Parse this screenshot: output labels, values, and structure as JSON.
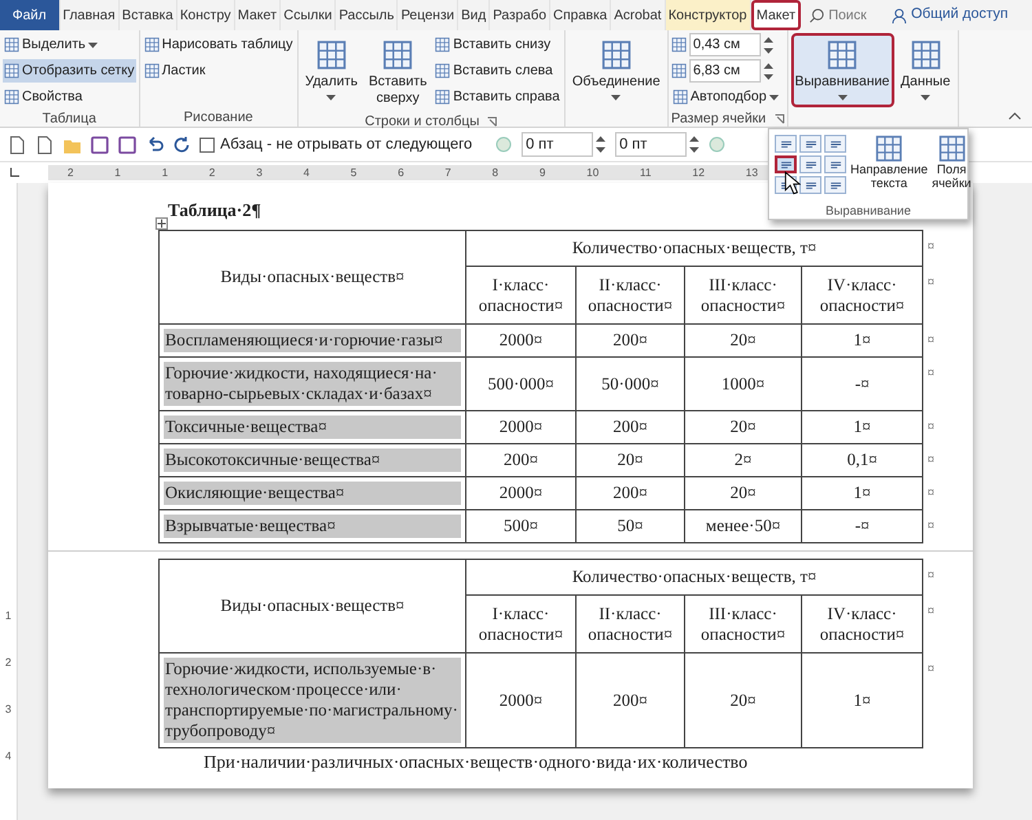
{
  "tabs": [
    {
      "label": "Файл",
      "kind": "file",
      "selected": false
    },
    {
      "label": "Главная",
      "kind": "tab",
      "selected": false
    },
    {
      "label": "Вставка",
      "kind": "tab",
      "selected": false
    },
    {
      "label": "Констру",
      "kind": "tab",
      "selected": false
    },
    {
      "label": "Макет",
      "kind": "tab",
      "selected": false
    },
    {
      "label": "Ссылки",
      "kind": "tab",
      "selected": false
    },
    {
      "label": "Рассыль",
      "kind": "tab",
      "selected": false
    },
    {
      "label": "Рецензи",
      "kind": "tab",
      "selected": false
    },
    {
      "label": "Вид",
      "kind": "tab",
      "selected": false
    },
    {
      "label": "Разрабо",
      "kind": "tab",
      "selected": false
    },
    {
      "label": "Справка",
      "kind": "tab",
      "selected": false
    },
    {
      "label": "Acrobat",
      "kind": "tab",
      "selected": false
    },
    {
      "label": "Конструктор",
      "kind": "context",
      "selected": false
    },
    {
      "label": "Макет",
      "kind": "context",
      "selected": true
    }
  ],
  "search": {
    "placeholder": "Поиск"
  },
  "share": {
    "label": "Общий доступ"
  },
  "ribbon": {
    "groups": [
      {
        "label": "Таблица",
        "launcher": false,
        "items": [
          {
            "kind": "small",
            "label": "Выделить",
            "dropdown": true,
            "active": false
          },
          {
            "kind": "small",
            "label": "Отобразить сетку",
            "dropdown": false,
            "active": true
          },
          {
            "kind": "small",
            "label": "Свойства",
            "dropdown": false,
            "active": false
          }
        ]
      },
      {
        "label": "Рисование",
        "launcher": false,
        "items": [
          {
            "kind": "small",
            "label": "Нарисовать таблицу",
            "dropdown": false,
            "active": false
          },
          {
            "kind": "small",
            "label": "Ластик",
            "dropdown": false,
            "active": false
          }
        ]
      },
      {
        "label": "Строки и столбцы",
        "launcher": true,
        "items": [
          {
            "kind": "large",
            "label": "Удалить",
            "dropdown": true,
            "active": false
          },
          {
            "kind": "large",
            "label": "Вставить сверху",
            "dropdown": false,
            "active": false
          },
          {
            "kind": "small",
            "label": "Вставить снизу",
            "dropdown": false,
            "active": false
          },
          {
            "kind": "small",
            "label": "Вставить слева",
            "dropdown": false,
            "active": false
          },
          {
            "kind": "small",
            "label": "Вставить справа",
            "dropdown": false,
            "active": false
          }
        ]
      },
      {
        "launcher": false,
        "items": [
          {
            "kind": "large",
            "label": "Объединение",
            "dropdown": true,
            "active": false
          }
        ]
      },
      {
        "label": "Размер ячейки",
        "launcher": true,
        "items": [
          {
            "kind": "field",
            "value": "0,43 см",
            "active": false
          },
          {
            "kind": "field",
            "value": "6,83 см",
            "active": false
          },
          {
            "kind": "small",
            "label": "Автоподбор",
            "dropdown": true,
            "active": false
          }
        ]
      },
      {
        "launcher": false,
        "items": [
          {
            "kind": "large",
            "label": "Выравнивание",
            "dropdown": true,
            "active": true
          },
          {
            "kind": "large",
            "label": "Данные",
            "dropdown": true,
            "active": false
          }
        ]
      }
    ]
  },
  "quick_access": {
    "checkbox": {
      "label": "Абзац - не отрывать от следующего",
      "checked": false
    },
    "fields": [
      {
        "value": "0 пт"
      },
      {
        "value": "0 пт"
      }
    ]
  },
  "ruler": {
    "numbers": [
      "2",
      "1",
      "1",
      "2",
      "3",
      "4",
      "5",
      "6",
      "7",
      "8",
      "9",
      "10",
      "11",
      "12",
      "13"
    ]
  },
  "vertical_ruler": {
    "numbers": [
      "1",
      "2",
      "3",
      "4"
    ]
  },
  "alignment_menu": {
    "cells": [
      {
        "selected": false
      },
      {
        "selected": false
      },
      {
        "selected": false
      },
      {
        "selected": true
      },
      {
        "selected": false
      },
      {
        "selected": false
      },
      {
        "selected": false
      },
      {
        "selected": false
      },
      {
        "selected": false
      }
    ],
    "buttons": [
      {
        "label": "Направление текста"
      },
      {
        "label": "Поля ячейки"
      }
    ],
    "label": "Выравнивание"
  },
  "document": {
    "caption": "Таблица·2¶",
    "tables": [
      {
        "header": {
          "name_heading": "Виды·опасных·веществ¤",
          "group_heading": "Количество·опасных·веществ, т¤",
          "class_headings": [
            "I·класс·опасности¤",
            "II·класс·опасности¤",
            "III·класс·опасности¤",
            "IV·класс·опасности¤"
          ],
          "end_marks": [
            "¤",
            "¤"
          ]
        },
        "rows": [
          {
            "name": "Воспламеняющиеся·и·горючие·газы¤",
            "values": [
              "2000¤",
              "200¤",
              "20¤",
              "1¤"
            ],
            "end_mark": "¤",
            "selected": true
          },
          {
            "name": "Горючие·жидкости, находящиеся·на·товарно-сырьевых·складах·и·базах¤",
            "values": [
              "500·000¤",
              "50·000¤",
              "1000¤",
              "-¤"
            ],
            "end_mark": "¤",
            "selected": true
          },
          {
            "name": "Токсичные·вещества¤",
            "values": [
              "2000¤",
              "200¤",
              "20¤",
              "1¤"
            ],
            "end_mark": "¤",
            "selected": true
          },
          {
            "name": "Высокотоксичные·вещества¤",
            "values": [
              "200¤",
              "20¤",
              "2¤",
              "0,1¤"
            ],
            "end_mark": "¤",
            "selected": true
          },
          {
            "name": "Окисляющие·вещества¤",
            "values": [
              "2000¤",
              "200¤",
              "20¤",
              "1¤"
            ],
            "end_mark": "¤",
            "selected": true
          },
          {
            "name": "Взрывчатые·вещества¤",
            "values": [
              "500¤",
              "50¤",
              "менее·50¤",
              "-¤"
            ],
            "end_mark": "¤",
            "selected": true
          }
        ]
      },
      {
        "header": {
          "name_heading": "Виды·опасных·веществ¤",
          "group_heading": "Количество·опасных·веществ, т¤",
          "class_headings": [
            "I·класс·опасности¤",
            "II·класс·опасности¤",
            "III·класс·опасности¤",
            "IV·класс·опасности¤"
          ],
          "end_marks": [
            "¤",
            "¤"
          ]
        },
        "rows": [
          {
            "name": "Горючие·жидкости, используемые·в·технологическом·процессе·или·транспортируемые·по·магистральному·трубопроводу¤",
            "values": [
              "2000¤",
              "200¤",
              "20¤",
              "1¤"
            ],
            "end_mark": "¤",
            "selected": true
          }
        ]
      }
    ],
    "paragraph": "При·наличии·различных·опасных·веществ·одного·вида·их·количество"
  }
}
